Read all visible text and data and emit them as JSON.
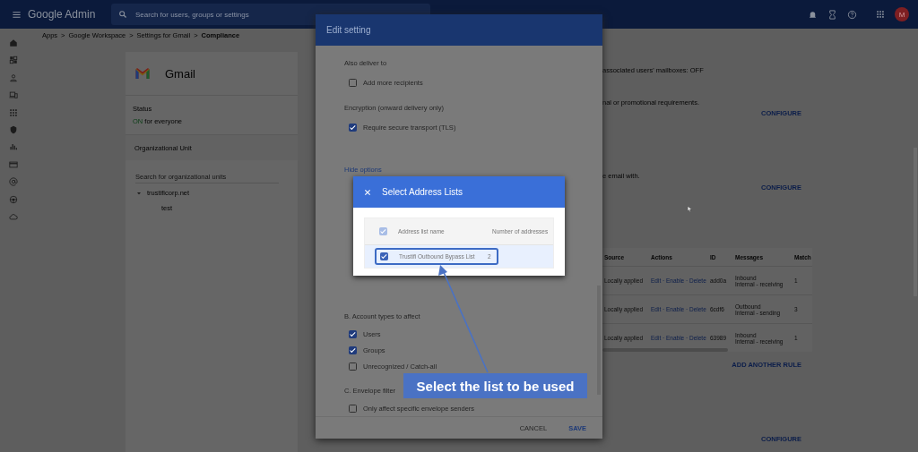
{
  "top_bar": {
    "title": "Google Admin",
    "search": {
      "placeholder": "Search for users, groups or settings"
    },
    "avatar": "M"
  },
  "breadcrumb": {
    "separator": ">",
    "items": [
      "Apps",
      "Google Workspace",
      "Settings for Gmail",
      "Compliance"
    ]
  },
  "app_card": {
    "name": "Gmail",
    "status_label": "Status",
    "status_value": "ON",
    "status_suffix": "for everyone",
    "org_unit_header": "Organizational Unit",
    "org_search": {
      "placeholder": "Search for organizational units"
    },
    "tree": [
      {
        "label": "trustificorp.net",
        "expanded": true,
        "children": [
          {
            "label": "test"
          }
        ]
      }
    ]
  },
  "main": {
    "lines": [
      {
        "kind": "text",
        "text": "associated users' mailboxes: OFF"
      },
      {
        "kind": "text",
        "text": "nal or promotional requirements."
      },
      {
        "kind": "action",
        "text": "CONFIGURE"
      },
      {
        "kind": "text",
        "text": "e email with."
      },
      {
        "kind": "action",
        "text": "CONFIGURE"
      }
    ],
    "table": {
      "columns": [
        "Source",
        "Actions",
        "ID",
        "Messages",
        "Match"
      ],
      "rows": [
        {
          "source": "Locally applied",
          "actions": "Edit · Enable · Delete",
          "id": "add0a",
          "messages": [
            "Inbound",
            "Internal - receiving"
          ],
          "match": "1"
        },
        {
          "source": "Locally applied",
          "actions": "Edit · Enable · Delete",
          "id": "6cdf6",
          "messages": [
            "Outbound",
            "Internal - sending"
          ],
          "match": "3"
        },
        {
          "source": "Locally applied",
          "actions": "Edit · Enable · Delete",
          "id": "63989",
          "messages": [
            "Inbound",
            "Internal - receiving"
          ],
          "match": "1"
        }
      ]
    },
    "add_rule": "ADD ANOTHER RULE",
    "bottom_action": "CONFIGURE"
  },
  "edit_dialog": {
    "title": "Edit setting",
    "top_items": [
      {
        "kind": "heading",
        "text": "Also deliver to"
      },
      {
        "kind": "checkbox",
        "label": "Add more recipients",
        "checked": false
      },
      {
        "kind": "heading",
        "text": "Encryption (onward delivery only)"
      },
      {
        "kind": "checkbox",
        "label": "Require secure transport (TLS)",
        "checked": true
      },
      {
        "kind": "link",
        "text": "Hide options"
      }
    ],
    "bottom_items": [
      {
        "kind": "heading",
        "text": "B. Account types to affect"
      },
      {
        "kind": "checkbox",
        "label": "Users",
        "checked": true
      },
      {
        "kind": "checkbox",
        "label": "Groups",
        "checked": true
      },
      {
        "kind": "checkbox",
        "label": "Unrecognized / Catch-all",
        "checked": false
      },
      {
        "kind": "heading",
        "text": "C. Envelope filter"
      },
      {
        "kind": "checkbox",
        "label": "Only affect specific envelope senders",
        "checked": false
      }
    ],
    "buttons": [
      {
        "label": "CANCEL",
        "primary": false
      },
      {
        "label": "SAVE",
        "primary": true
      }
    ]
  },
  "address_dialog": {
    "title": "Select Address Lists",
    "columns": [
      "Address list name",
      "Number of addresses"
    ],
    "all_checked": true,
    "rows": [
      {
        "name": "Trustifi Outbound Bypass List",
        "count": "2",
        "checked": true,
        "selected": true,
        "highlighted": true
      }
    ]
  },
  "annotation": {
    "text": "Select the list to be used"
  }
}
